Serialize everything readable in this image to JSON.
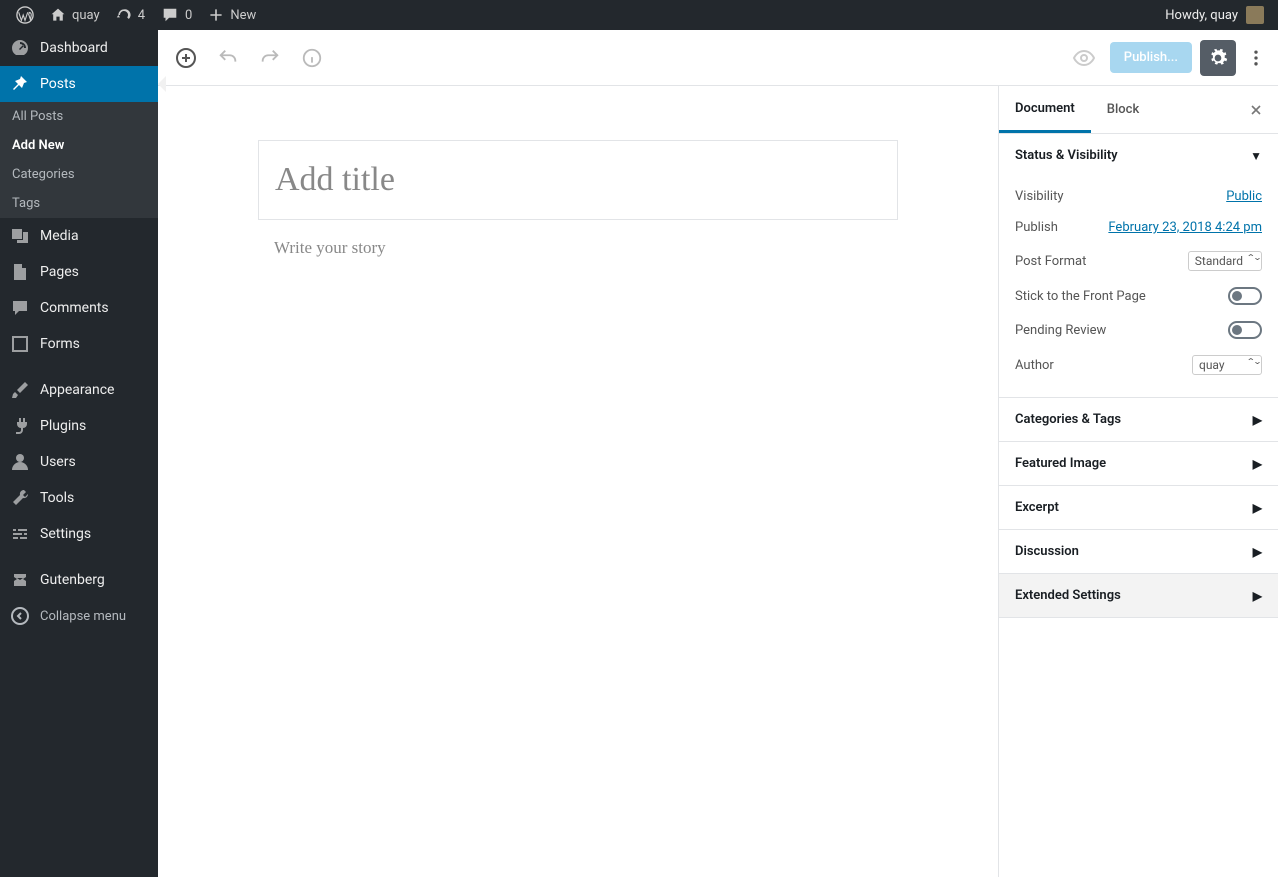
{
  "adminbar": {
    "site_name": "quay",
    "updates_count": "4",
    "comments_count": "0",
    "new_label": "New",
    "howdy": "Howdy, quay"
  },
  "sidebar": {
    "items": [
      {
        "label": "Dashboard",
        "icon": "dashboard"
      },
      {
        "label": "Posts",
        "icon": "pin",
        "current": true,
        "submenu": [
          {
            "label": "All Posts"
          },
          {
            "label": "Add New",
            "current": true
          },
          {
            "label": "Categories"
          },
          {
            "label": "Tags"
          }
        ]
      },
      {
        "label": "Media",
        "icon": "media"
      },
      {
        "label": "Pages",
        "icon": "page"
      },
      {
        "label": "Comments",
        "icon": "comment"
      },
      {
        "label": "Forms",
        "icon": "forms"
      },
      {
        "sep": true
      },
      {
        "label": "Appearance",
        "icon": "brush"
      },
      {
        "label": "Plugins",
        "icon": "plug"
      },
      {
        "label": "Users",
        "icon": "user"
      },
      {
        "label": "Tools",
        "icon": "wrench"
      },
      {
        "label": "Settings",
        "icon": "sliders"
      },
      {
        "sep": true
      },
      {
        "label": "Gutenberg",
        "icon": "gutenberg"
      }
    ],
    "collapse_label": "Collapse menu"
  },
  "toolbar": {
    "publish_label": "Publish..."
  },
  "editor": {
    "title_placeholder": "Add title",
    "body_placeholder": "Write your story"
  },
  "panel": {
    "tabs": {
      "document": "Document",
      "block": "Block"
    },
    "status_visibility": {
      "title": "Status & Visibility",
      "visibility_label": "Visibility",
      "visibility_value": "Public",
      "publish_label": "Publish",
      "publish_value": "February 23, 2018 4:24 pm",
      "post_format_label": "Post Format",
      "post_format_value": "Standard",
      "stick_label": "Stick to the Front Page",
      "pending_label": "Pending Review",
      "author_label": "Author",
      "author_value": "quay"
    },
    "sections": {
      "categories": "Categories & Tags",
      "featured": "Featured Image",
      "excerpt": "Excerpt",
      "discussion": "Discussion",
      "extended": "Extended Settings"
    }
  }
}
